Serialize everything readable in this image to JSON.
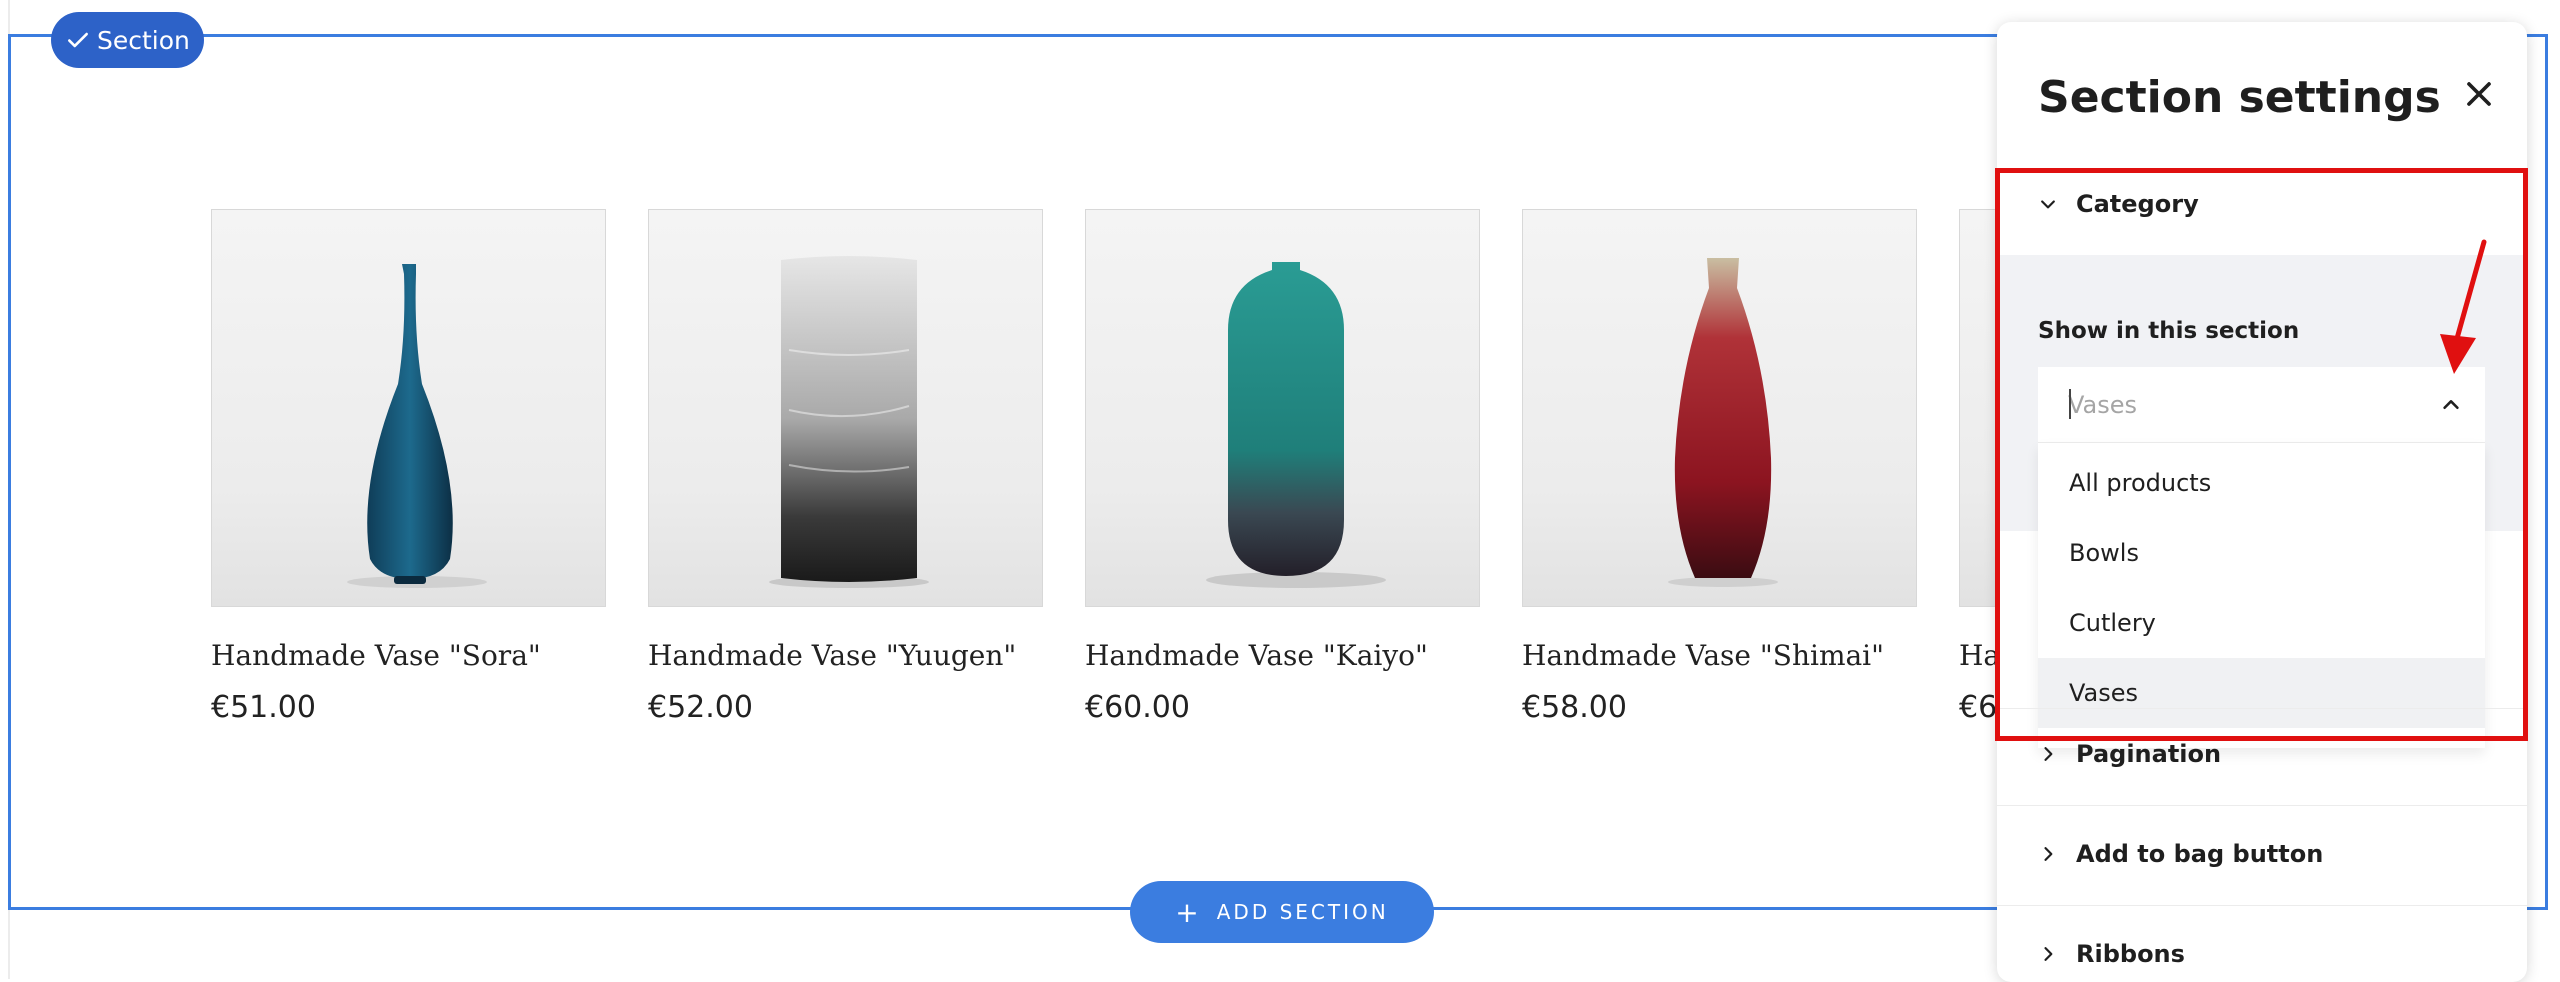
{
  "section_badge": {
    "label": "Section"
  },
  "products": [
    {
      "name": "Handmade Vase \"Sora\"",
      "price": "€51.00"
    },
    {
      "name": "Handmade Vase \"Yuugen\"",
      "price": "€52.00"
    },
    {
      "name": "Handmade Vase \"Kaiyo\"",
      "price": "€60.00"
    },
    {
      "name": "Handmade Vase \"Shimai\"",
      "price": "€58.00"
    },
    {
      "name": "Ha",
      "price": "€6"
    }
  ],
  "add_section": {
    "label": "ADD SECTION"
  },
  "panel": {
    "title": "Section settings",
    "category": {
      "header": "Category",
      "show_label": "Show in this section",
      "select_value": "Vases",
      "options": [
        "All products",
        "Bowls",
        "Cutlery",
        "Vases"
      ],
      "selected": "Vases"
    },
    "sections": [
      "Pagination",
      "Add to bag button",
      "Ribbons"
    ]
  },
  "colors": {
    "accent": "#3b7de0",
    "badge": "#2d62c8",
    "highlight": "#e01010"
  },
  "icons": [
    "check-icon",
    "plus-icon",
    "close-icon",
    "chevron-down-icon",
    "chevron-right-icon",
    "chevron-up-icon"
  ]
}
